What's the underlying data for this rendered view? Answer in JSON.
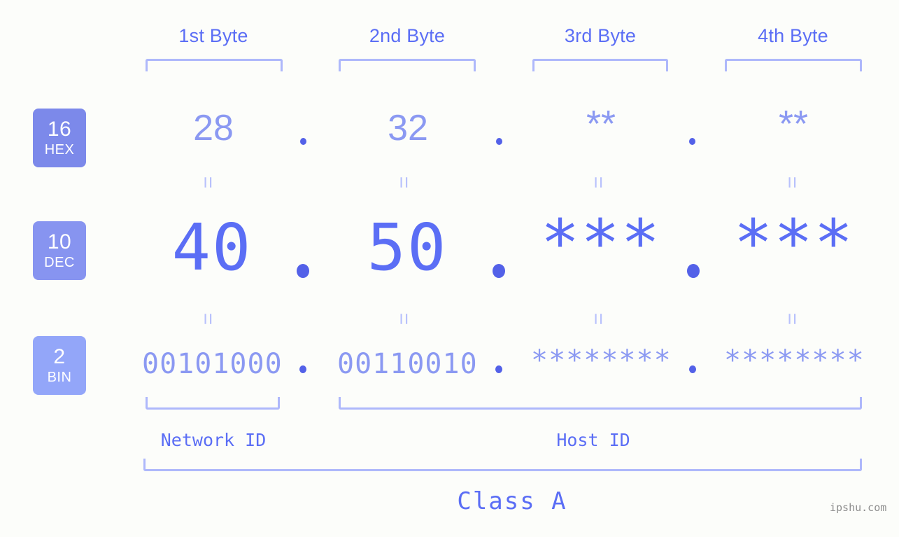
{
  "meta": {
    "background": "#fcfdfa",
    "accent": "#5b6ef5",
    "accent_light": "#8b99f2",
    "bracket_color": "#aeb8fb",
    "watermark": "ipshu.com"
  },
  "columns": [
    {
      "label": "1st Byte"
    },
    {
      "label": "2nd Byte"
    },
    {
      "label": "3rd Byte"
    },
    {
      "label": "4th Byte"
    }
  ],
  "rows": [
    {
      "badge": {
        "num": "16",
        "name": "HEX",
        "color": "#7c89ea"
      },
      "values": [
        "28",
        "32",
        "**",
        "**"
      ],
      "separator": "."
    },
    {
      "badge": {
        "num": "10",
        "name": "DEC",
        "color": "#8794f0"
      },
      "values": [
        "40",
        "50",
        "***",
        "***"
      ],
      "separator": "."
    },
    {
      "badge": {
        "num": "2",
        "name": "BIN",
        "color": "#93a6f9"
      },
      "values": [
        "00101000",
        "00110010",
        "********",
        "********"
      ],
      "separator": "."
    }
  ],
  "equals_glyph": "=",
  "footer": {
    "network_id_label": "Network ID",
    "host_id_label": "Host ID",
    "class_label": "Class A"
  }
}
